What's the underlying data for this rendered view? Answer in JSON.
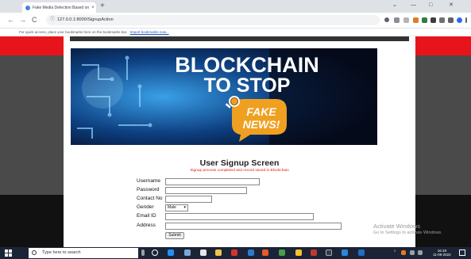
{
  "browser": {
    "tab_title": "Fake Media Detection Based on",
    "tab_close": "×",
    "new_tab": "+",
    "minimize": "—",
    "maximize": "□",
    "close": "✕",
    "chevron": "⌄",
    "back": "←",
    "forward": "→",
    "reload": "C",
    "url": "127.0.0.1:8000/SignupAction",
    "bookmarks_text": "For quick access, place your bookmarks here on the bookmarks bar.",
    "bookmarks_link": "Import bookmarks now..."
  },
  "banner": {
    "line1": "BLOCKCHAIN",
    "line2": "TO STOP",
    "line3": "FAKE",
    "line4": "NEWS!"
  },
  "form": {
    "title": "User Signup Screen",
    "status": "Signup process completed and record saved in Blockchain",
    "username_label": "Username",
    "password_label": "Password",
    "contact_label": "Contact No",
    "gender_label": "Gender",
    "gender_value": "Male",
    "email_label": "Email ID",
    "address_label": "Address",
    "submit_label": "Submit"
  },
  "watermark": {
    "line1": "Activate Windows",
    "line2": "Go to Settings to activate Windows."
  },
  "taskbar": {
    "search_placeholder": "Type here to search",
    "time": "16:18",
    "date": "11-09-2022"
  },
  "colors": {
    "accent_red": "#e8141b",
    "page_bg": "#4a4a4a",
    "taskbar": "#1b2436",
    "banner_bg": "#0a2a5c",
    "badge_orange": "#f0a020"
  }
}
